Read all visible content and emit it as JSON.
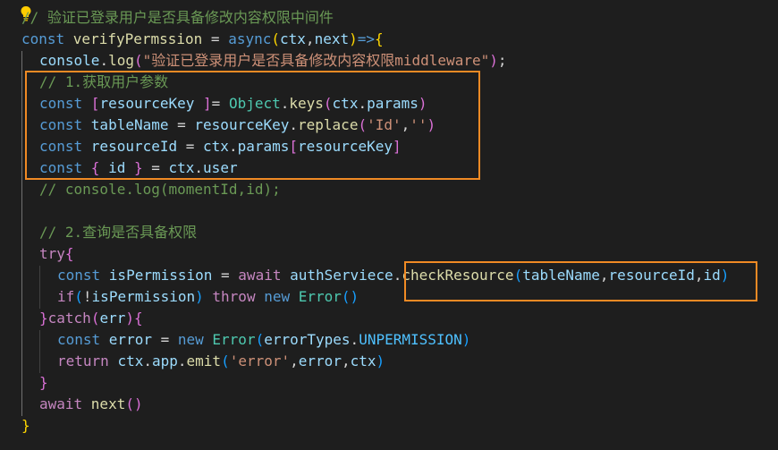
{
  "colors": {
    "background": "#1e1e1e",
    "highlight_box": "#f08a24"
  },
  "lines": [
    {
      "tokens": [
        {
          "t": "// 验证已登录用户是否具备修改内容权限中间件",
          "c": "cmt"
        }
      ]
    },
    {
      "tokens": [
        {
          "t": "const ",
          "c": "kw"
        },
        {
          "t": "verifyPermssion",
          "c": "fn"
        },
        {
          "t": " = ",
          "c": "op"
        },
        {
          "t": "async",
          "c": "kw"
        },
        {
          "t": "(",
          "c": "b1"
        },
        {
          "t": "ctx",
          "c": "var"
        },
        {
          "t": ",",
          "c": "op"
        },
        {
          "t": "next",
          "c": "var"
        },
        {
          "t": ")",
          "c": "b1"
        },
        {
          "t": "=>",
          "c": "kw"
        },
        {
          "t": "{",
          "c": "b1"
        }
      ]
    },
    {
      "tokens": [
        {
          "t": "console",
          "c": "var"
        },
        {
          "t": ".",
          "c": "op"
        },
        {
          "t": "log",
          "c": "fn"
        },
        {
          "t": "(",
          "c": "b2"
        },
        {
          "t": "\"验证已登录用户是否具备修改内容权限middleware\"",
          "c": "str"
        },
        {
          "t": ")",
          "c": "b2"
        },
        {
          "t": ";",
          "c": "op"
        }
      ]
    },
    {
      "tokens": [
        {
          "t": "// 1.获取用户参数",
          "c": "cmt"
        }
      ]
    },
    {
      "tokens": [
        {
          "t": "const ",
          "c": "kw"
        },
        {
          "t": "[",
          "c": "b2"
        },
        {
          "t": "resourceKey",
          "c": "var"
        },
        {
          "t": " ]",
          "c": "b2"
        },
        {
          "t": "= ",
          "c": "op"
        },
        {
          "t": "Object",
          "c": "type"
        },
        {
          "t": ".",
          "c": "op"
        },
        {
          "t": "keys",
          "c": "fn"
        },
        {
          "t": "(",
          "c": "b2"
        },
        {
          "t": "ctx",
          "c": "var"
        },
        {
          "t": ".",
          "c": "op"
        },
        {
          "t": "params",
          "c": "var"
        },
        {
          "t": ")",
          "c": "b2"
        }
      ]
    },
    {
      "tokens": [
        {
          "t": "const ",
          "c": "kw"
        },
        {
          "t": "tableName",
          "c": "var"
        },
        {
          "t": " = ",
          "c": "op"
        },
        {
          "t": "resourceKey",
          "c": "var"
        },
        {
          "t": ".",
          "c": "op"
        },
        {
          "t": "replace",
          "c": "fn"
        },
        {
          "t": "(",
          "c": "b2"
        },
        {
          "t": "'Id'",
          "c": "str"
        },
        {
          "t": ",",
          "c": "op"
        },
        {
          "t": "''",
          "c": "str"
        },
        {
          "t": ")",
          "c": "b2"
        }
      ]
    },
    {
      "tokens": [
        {
          "t": "const ",
          "c": "kw"
        },
        {
          "t": "resourceId",
          "c": "var"
        },
        {
          "t": " = ",
          "c": "op"
        },
        {
          "t": "ctx",
          "c": "var"
        },
        {
          "t": ".",
          "c": "op"
        },
        {
          "t": "params",
          "c": "var"
        },
        {
          "t": "[",
          "c": "b2"
        },
        {
          "t": "resourceKey",
          "c": "var"
        },
        {
          "t": "]",
          "c": "b2"
        }
      ]
    },
    {
      "tokens": [
        {
          "t": "const ",
          "c": "kw"
        },
        {
          "t": "{ ",
          "c": "b2"
        },
        {
          "t": "id",
          "c": "var"
        },
        {
          "t": " }",
          "c": "b2"
        },
        {
          "t": " = ",
          "c": "op"
        },
        {
          "t": "ctx",
          "c": "var"
        },
        {
          "t": ".",
          "c": "op"
        },
        {
          "t": "user",
          "c": "var"
        }
      ]
    },
    {
      "tokens": [
        {
          "t": "// console.log(momentId,id);",
          "c": "cmt"
        }
      ]
    },
    {
      "tokens": []
    },
    {
      "tokens": [
        {
          "t": "// 2.查询是否具备权限",
          "c": "cmt"
        }
      ]
    },
    {
      "tokens": [
        {
          "t": "try",
          "c": "ctl"
        },
        {
          "t": "{",
          "c": "b2"
        }
      ]
    },
    {
      "tokens": [
        {
          "t": "const ",
          "c": "kw"
        },
        {
          "t": "isPermission",
          "c": "var"
        },
        {
          "t": " = ",
          "c": "op"
        },
        {
          "t": "await ",
          "c": "ctl"
        },
        {
          "t": "authServiece",
          "c": "var"
        },
        {
          "t": ".",
          "c": "op"
        },
        {
          "t": "checkResource",
          "c": "fn"
        },
        {
          "t": "(",
          "c": "b3"
        },
        {
          "t": "tableName",
          "c": "var"
        },
        {
          "t": ",",
          "c": "op"
        },
        {
          "t": "resourceId",
          "c": "var"
        },
        {
          "t": ",",
          "c": "op"
        },
        {
          "t": "id",
          "c": "var"
        },
        {
          "t": ")",
          "c": "b3"
        }
      ]
    },
    {
      "tokens": [
        {
          "t": "if",
          "c": "ctl"
        },
        {
          "t": "(",
          "c": "b3"
        },
        {
          "t": "!",
          "c": "op"
        },
        {
          "t": "isPermission",
          "c": "var"
        },
        {
          "t": ") ",
          "c": "b3"
        },
        {
          "t": "throw ",
          "c": "ctl"
        },
        {
          "t": "new ",
          "c": "kw"
        },
        {
          "t": "Error",
          "c": "type"
        },
        {
          "t": "()",
          "c": "b3"
        }
      ]
    },
    {
      "tokens": [
        {
          "t": "}",
          "c": "b2"
        },
        {
          "t": "catch",
          "c": "ctl"
        },
        {
          "t": "(",
          "c": "b2"
        },
        {
          "t": "err",
          "c": "var"
        },
        {
          "t": ")",
          "c": "b2"
        },
        {
          "t": "{",
          "c": "b2"
        }
      ]
    },
    {
      "tokens": [
        {
          "t": "const ",
          "c": "kw"
        },
        {
          "t": "error",
          "c": "var"
        },
        {
          "t": " = ",
          "c": "op"
        },
        {
          "t": "new ",
          "c": "kw"
        },
        {
          "t": "Error",
          "c": "type"
        },
        {
          "t": "(",
          "c": "b3"
        },
        {
          "t": "errorTypes",
          "c": "var"
        },
        {
          "t": ".",
          "c": "op"
        },
        {
          "t": "UNPERMISSION",
          "c": "const"
        },
        {
          "t": ")",
          "c": "b3"
        }
      ]
    },
    {
      "tokens": [
        {
          "t": "return ",
          "c": "ctl"
        },
        {
          "t": "ctx",
          "c": "var"
        },
        {
          "t": ".",
          "c": "op"
        },
        {
          "t": "app",
          "c": "var"
        },
        {
          "t": ".",
          "c": "op"
        },
        {
          "t": "emit",
          "c": "fn"
        },
        {
          "t": "(",
          "c": "b3"
        },
        {
          "t": "'error'",
          "c": "str"
        },
        {
          "t": ",",
          "c": "op"
        },
        {
          "t": "error",
          "c": "var"
        },
        {
          "t": ",",
          "c": "op"
        },
        {
          "t": "ctx",
          "c": "var"
        },
        {
          "t": ")",
          "c": "b3"
        }
      ]
    },
    {
      "tokens": [
        {
          "t": "}",
          "c": "b2"
        }
      ]
    },
    {
      "tokens": [
        {
          "t": "await ",
          "c": "ctl"
        },
        {
          "t": "next",
          "c": "fn"
        },
        {
          "t": "()",
          "c": "b2"
        }
      ]
    },
    {
      "tokens": [
        {
          "t": "}",
          "c": "b1"
        }
      ]
    }
  ]
}
